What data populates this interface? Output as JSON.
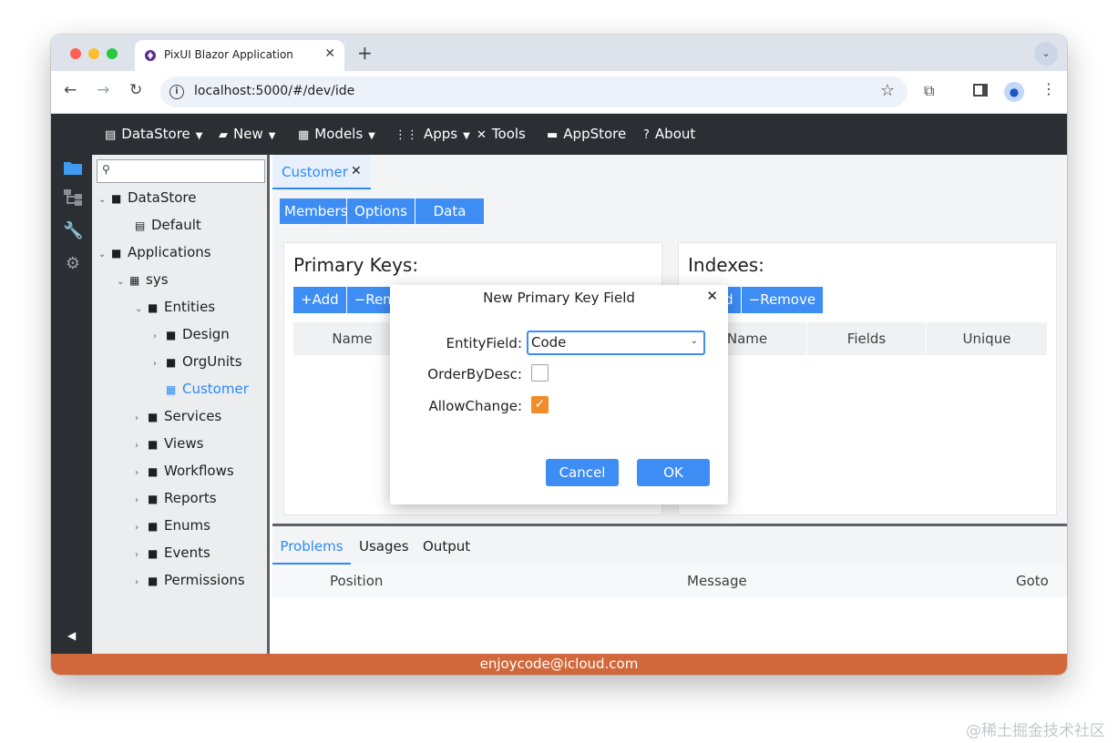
{
  "browser": {
    "tab_title": "PixUI Blazor Application",
    "tab_close": "✕",
    "new_tab": "+",
    "url": "localhost:5000/#/dev/ide"
  },
  "menubar": [
    {
      "label": "DataStore",
      "icon": "database-icon",
      "has_dropdown": true
    },
    {
      "label": "New",
      "icon": "new-file-icon",
      "has_dropdown": true
    },
    {
      "label": "Models",
      "icon": "models-grid-icon",
      "has_dropdown": true
    },
    {
      "label": "Apps",
      "icon": "apps-grid-icon",
      "has_dropdown": true
    },
    {
      "label": "Tools",
      "icon": "tools-icon",
      "has_dropdown": false
    },
    {
      "label": "AppStore",
      "icon": "store-icon",
      "has_dropdown": false
    },
    {
      "label": "About",
      "icon": "help-icon",
      "has_dropdown": false
    }
  ],
  "tree": {
    "search_placeholder": "",
    "nodes": [
      {
        "label": "DataStore",
        "expanded": true
      },
      {
        "label": "Default"
      },
      {
        "label": "Applications",
        "expanded": true
      },
      {
        "label": "sys",
        "expanded": true
      },
      {
        "label": "Entities",
        "expanded": true
      },
      {
        "label": "Design",
        "expanded": false
      },
      {
        "label": "OrgUnits",
        "expanded": false
      },
      {
        "label": "Customer",
        "selected": true
      },
      {
        "label": "Services",
        "expanded": false
      },
      {
        "label": "Views",
        "expanded": false
      },
      {
        "label": "Workflows",
        "expanded": false
      },
      {
        "label": "Reports",
        "expanded": false
      },
      {
        "label": "Enums",
        "expanded": false
      },
      {
        "label": "Events",
        "expanded": false
      },
      {
        "label": "Permissions",
        "expanded": false
      }
    ]
  },
  "editor": {
    "doc_tab": "Customer",
    "doc_tab_close": "✕",
    "segments": [
      "Members",
      "Options",
      "Data"
    ],
    "primary_keys": {
      "title": "Primary Keys:",
      "add_label": "Add",
      "remove_label": "Remove",
      "columns": [
        "Name"
      ]
    },
    "indexes": {
      "title": "Indexes:",
      "add_label": "Add",
      "remove_label": "Remove",
      "columns": [
        "Name",
        "Fields",
        "Unique"
      ]
    }
  },
  "bottom_panel": {
    "tabs": [
      "Problems",
      "Usages",
      "Output"
    ],
    "active_tab": "Problems",
    "columns": [
      "Position",
      "Message",
      "Goto"
    ]
  },
  "dialog": {
    "title": "New Primary Key Field",
    "close": "✕",
    "entity_field_label": "EntityField:",
    "entity_field_value": "Code",
    "order_by_desc_label": "OrderByDesc:",
    "order_by_desc_checked": false,
    "allow_change_label": "AllowChange:",
    "allow_change_checked": true,
    "cancel_label": "Cancel",
    "ok_label": "OK"
  },
  "footer": {
    "text": "enjoycode@icloud.com"
  },
  "watermark": "@稀土掘金技术社区",
  "colors": {
    "accent": "#3d8df5",
    "menubar_bg": "#2b2f33",
    "footer_bg": "#d1683c",
    "checkbox_checked": "#f28c28",
    "selected_tree_item": "#2b8af7"
  }
}
